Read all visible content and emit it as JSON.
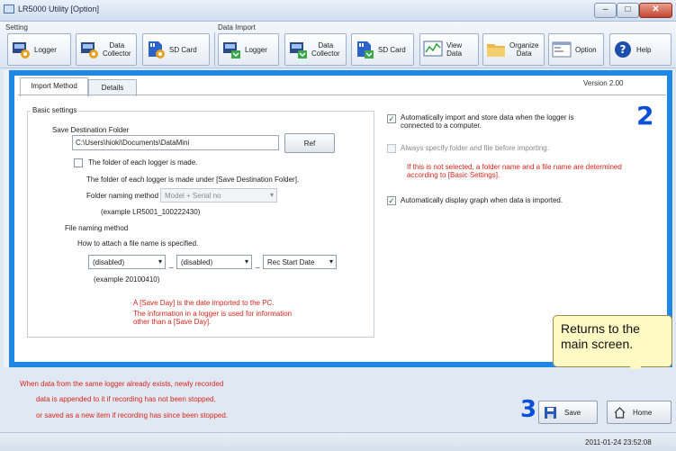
{
  "window": {
    "title": "LR5000 Utility [Option]"
  },
  "toolbar": {
    "setting_label": "Setting",
    "data_import_label": "Data Import",
    "setting_buttons": [
      "Logger",
      "Data\nCollector",
      "SD Card"
    ],
    "import_buttons": [
      "Logger",
      "Data\nCollector",
      "SD Card"
    ],
    "view_data": "View\nData",
    "organize_data": "Organize\nData",
    "option": "Option",
    "help": "Help"
  },
  "tabs": [
    "Import Method",
    "Details"
  ],
  "version": "Version   2.00",
  "annotations": {
    "num2": "2",
    "num3": "3",
    "callout": "Returns to the main screen."
  },
  "basic": {
    "legend": "Basic settings",
    "save_dest_label": "Save Destination Folder",
    "save_dest_value": "C:\\Users\\hioki\\Documents\\DataMini",
    "ref_button": "Ref",
    "folder_each_logger": "The folder of each logger is made.",
    "folder_under": "The folder of each logger is made under [Save Destination Folder].",
    "folder_naming_label": "Folder naming method",
    "folder_naming_value": "Model + Serial no",
    "folder_example": "(example      LR5001_100222430)",
    "file_naming_label": "File naming method",
    "how_attach": "How to attach a file name is specified.",
    "select1": "(disabled)",
    "select2": "(disabled)",
    "select3": "Rec Start Date",
    "file_example": "(example     20100410)",
    "red_note1": "A [Save Day] is the date imported to the PC.",
    "red_note2": "The information in a logger is used for information",
    "red_note3": "other than a [Save Day]."
  },
  "right": {
    "auto_import": "Automatically import and store data when the logger is",
    "auto_import2": "connected to a computer.",
    "always_specify": "Always specify folder and file before importing.",
    "red1": "If this is not selected, a folder name and a file name are determined",
    "red2": "according to [Basic Settings].",
    "auto_display": "Automatically display graph when data is imported."
  },
  "bottom": {
    "note1": "When data from the same logger already exists, newly recorded",
    "note2": "data is appended to it if recording has not been stopped,",
    "note3": "or saved as a new item if recording has since been stopped.",
    "save": "Save",
    "home": "Home"
  },
  "status": {
    "datetime": "2011-01-24 23:52:08"
  },
  "colors": {
    "accent_frame": "#1f88e6",
    "annotation_number": "#0a4fd8",
    "note_red": "#d8261c",
    "callout_bg": "#fff9c4"
  }
}
